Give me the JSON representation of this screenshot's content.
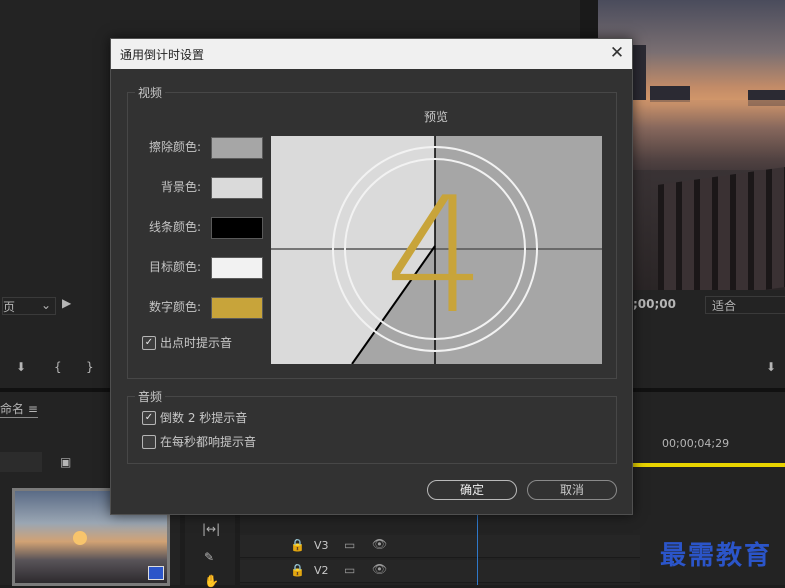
{
  "dialog": {
    "title": "通用倒计时设置",
    "close_symbol": "✕",
    "video_group": "视频",
    "preview_label": "预览",
    "rows": [
      {
        "label": "擦除颜色:",
        "color": "#a6a6a6"
      },
      {
        "label": "背景色:",
        "color": "#dadada"
      },
      {
        "label": "线条颜色:",
        "color": "#000000"
      },
      {
        "label": "目标颜色:",
        "color": "#f2f2f2"
      },
      {
        "label": "数字颜色:",
        "color": "#c8a43a"
      }
    ],
    "cue_at_out": {
      "label": "出点时提示音",
      "checked": true
    },
    "audio_group": "音频",
    "cue_2sec": {
      "label": "倒数 2 秒提示音",
      "checked": true
    },
    "cue_every_sec": {
      "label": "在每秒都响提示音",
      "checked": false
    },
    "ok_label": "确定",
    "cancel_label": "取消",
    "preview_digit": "4"
  },
  "background": {
    "left_label": "页",
    "timecode": ";00;00",
    "fit_label": "适合",
    "project_label": "命名",
    "timeline_time": "00;00;04;29",
    "tracks": [
      "V3",
      "V2"
    ]
  },
  "watermark": "最需教育"
}
